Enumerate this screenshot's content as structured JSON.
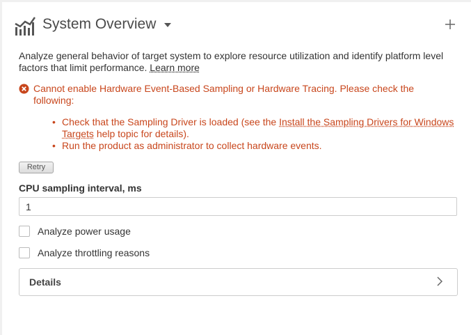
{
  "header": {
    "title": "System Overview",
    "icons": {
      "analysis": "bar-chart-icon",
      "dropdown": "caret-down-icon",
      "add": "plus-icon"
    }
  },
  "description": {
    "text": "Analyze general behavior of target system to explore resource utilization and identify platform level factors that limit performance.",
    "link_label": "Learn more"
  },
  "error": {
    "icon": "error-circle-icon",
    "message": "Cannot enable Hardware Event-Based Sampling or Hardware Tracing. Please check the following:",
    "items": [
      {
        "prefix": "Check that the Sampling Driver is loaded (see the",
        "link": "Install the Sampling Drivers for Windows Targets",
        "suffix": "help topic for details)."
      },
      {
        "text": "Run the product as administrator to collect hardware events."
      }
    ],
    "color": "#c8461c"
  },
  "retry_label": "Retry",
  "sampling": {
    "label": "CPU sampling interval, ms",
    "value": "1"
  },
  "options": [
    {
      "label": "Analyze power usage",
      "checked": false
    },
    {
      "label": "Analyze throttling reasons",
      "checked": false
    }
  ],
  "details": {
    "label": "Details",
    "icon": "chevron-right-icon"
  }
}
